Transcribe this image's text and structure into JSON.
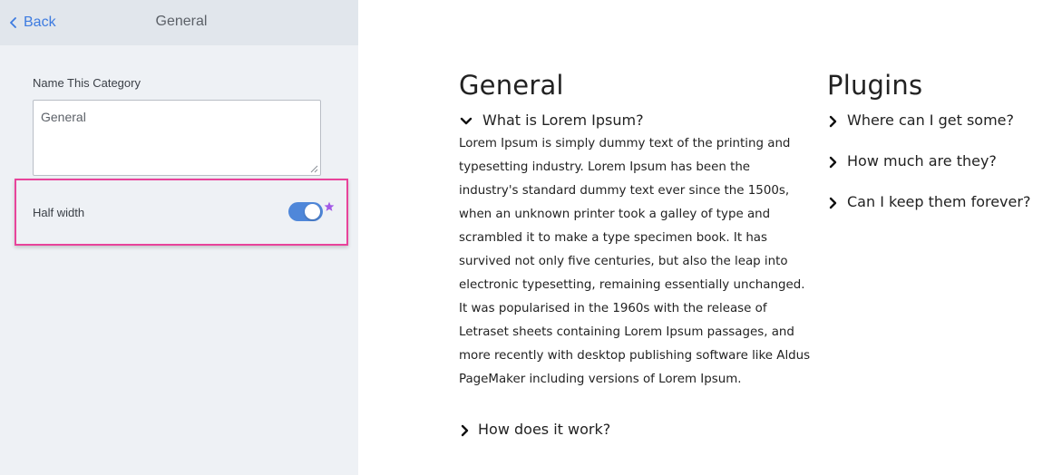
{
  "panel": {
    "back_label": "Back",
    "title": "General",
    "name_field": {
      "label": "Name This Category",
      "value": "General"
    },
    "half_width": {
      "label": "Half width",
      "enabled": true
    }
  },
  "preview": {
    "general": {
      "heading": "General",
      "questions": [
        {
          "text": "What is Lorem Ipsum?",
          "expanded": true,
          "answer": "Lorem Ipsum is simply dummy text of the printing and typesetting industry. Lorem Ipsum has been the industry's standard dummy text ever since the 1500s, when an unknown printer took a galley of type and scrambled it to make a type specimen book. It has survived not only five centuries, but also the leap into electronic typesetting, remaining essentially unchanged. It was popularised in the 1960s with the release of Letraset sheets containing Lorem Ipsum passages, and more recently with desktop publishing software like Aldus PageMaker including versions of Lorem Ipsum."
        },
        {
          "text": "How does it work?",
          "expanded": false
        }
      ]
    },
    "plugins": {
      "heading": "Plugins",
      "questions": [
        {
          "text": "Where can I get some?",
          "expanded": false
        },
        {
          "text": "How much are they?",
          "expanded": false
        },
        {
          "text": "Can I keep them forever?",
          "expanded": false
        }
      ]
    }
  },
  "colors": {
    "accent": "#3d7be0",
    "toggle_on": "#4f87d9",
    "highlight_border": "#e8449b",
    "star": "#a259e6"
  },
  "icons": {
    "back": "chevron-left-icon",
    "expanded": "chevron-down-icon",
    "collapsed": "chevron-right-icon",
    "star": "star-icon"
  }
}
